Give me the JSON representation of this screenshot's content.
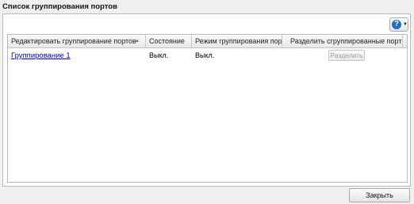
{
  "page": {
    "title": "Список группирования портов"
  },
  "toolbar": {
    "help_icon": "question-circle-icon",
    "help_glyph": "?",
    "caret_glyph": "▼"
  },
  "table": {
    "columns": [
      {
        "label": "Редактировать группирование портов",
        "sort": "ascending"
      },
      {
        "label": "Состояние"
      },
      {
        "label": "Режим группирования портов"
      },
      {
        "label": "Разделить сгруппированные порты"
      }
    ],
    "sort_glyph": "▲",
    "rows": [
      {
        "name": "Группирование 1",
        "state": "Выкл.",
        "mode": "Выкл.",
        "split_label": "Разделить",
        "split_enabled": false
      }
    ]
  },
  "footer": {
    "close_label": "Закрыть"
  }
}
